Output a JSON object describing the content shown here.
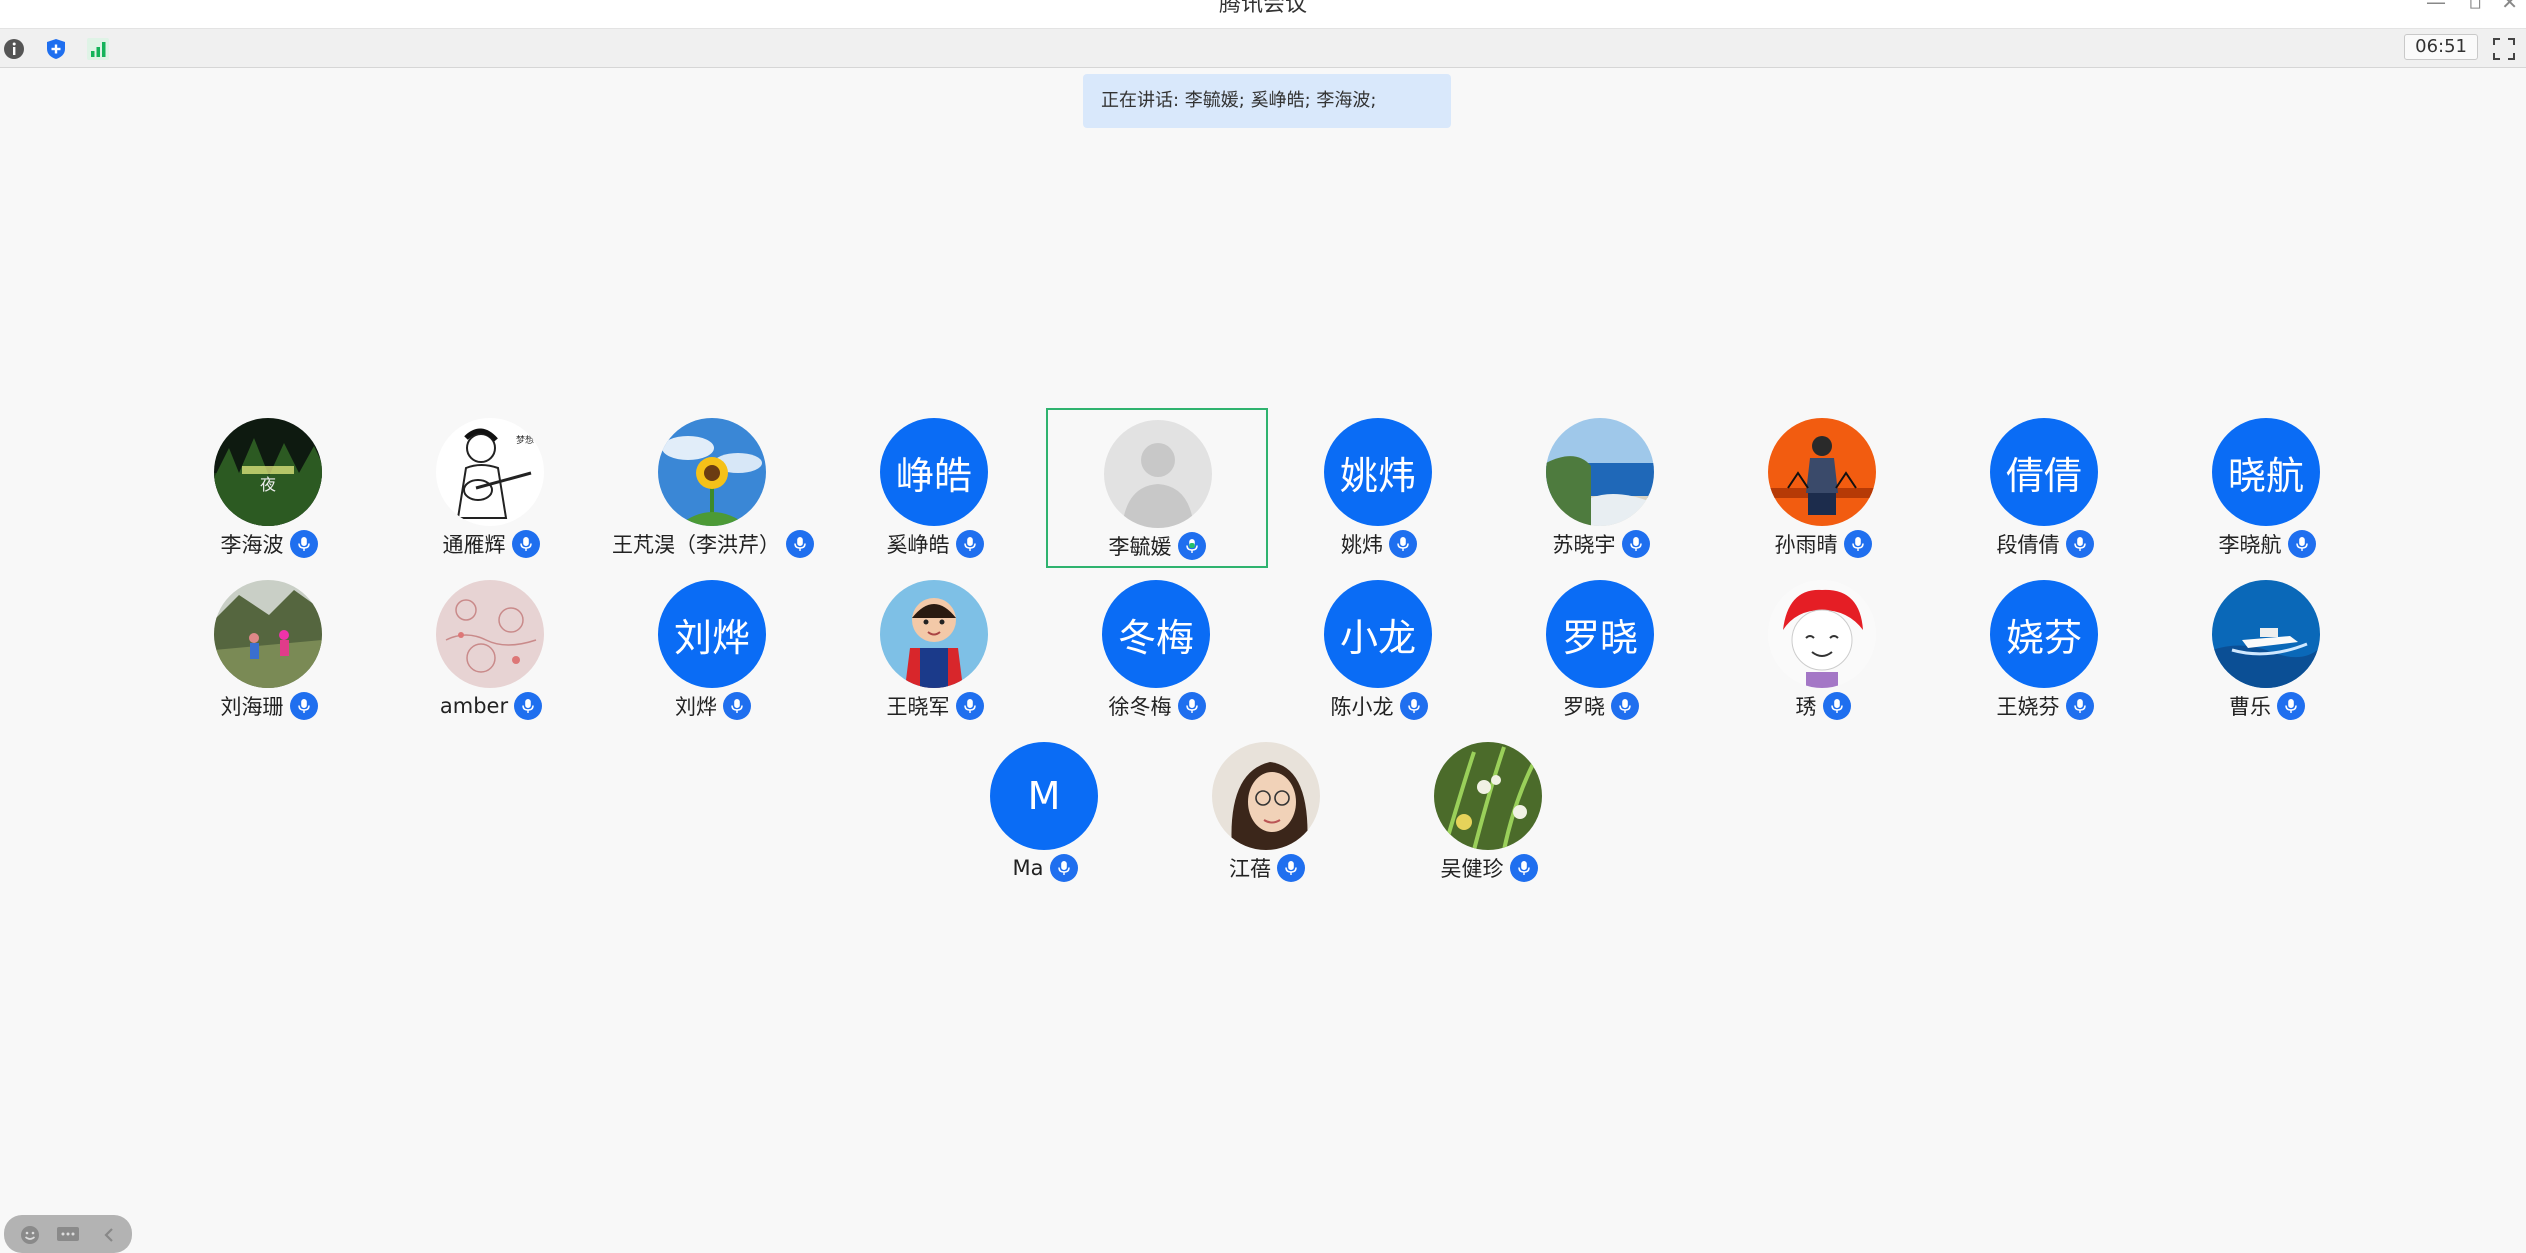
{
  "window": {
    "title": "腾讯会议"
  },
  "toolbar": {
    "timer": "06:51"
  },
  "banner": {
    "speaking_text": "正在讲话: 李毓媛; 奚峥皓; 李海波;"
  },
  "colors": {
    "accent": "#0a6cf5",
    "active_border": "#2fb36f",
    "banner_bg": "#d9e8fb"
  },
  "participants": [
    {
      "name": "李海波",
      "avatar": "photo-night-forest",
      "initials": ""
    },
    {
      "name": "通雁辉",
      "avatar": "photo-sketch-guitar",
      "initials": ""
    },
    {
      "name": "王芃淏（李洪芹）",
      "avatar": "photo-sunflower-sky",
      "initials": ""
    },
    {
      "name": "奚峥皓",
      "avatar": "initials",
      "initials": "峥皓"
    },
    {
      "name": "李毓媛",
      "avatar": "default-user",
      "initials": "",
      "active": true
    },
    {
      "name": "姚炜",
      "avatar": "initials",
      "initials": "姚炜"
    },
    {
      "name": "苏晓宇",
      "avatar": "photo-sea-coast",
      "initials": ""
    },
    {
      "name": "孙雨晴",
      "avatar": "photo-orange-figure",
      "initials": ""
    },
    {
      "name": "段倩倩",
      "avatar": "initials",
      "initials": "倩倩"
    },
    {
      "name": "李晓航",
      "avatar": "initials",
      "initials": "晓航"
    },
    {
      "name": "刘海珊",
      "avatar": "photo-mountain-people",
      "initials": ""
    },
    {
      "name": "amber",
      "avatar": "photo-pink-pattern",
      "initials": ""
    },
    {
      "name": "刘烨",
      "avatar": "initials",
      "initials": "刘烨"
    },
    {
      "name": "王晓军",
      "avatar": "photo-child",
      "initials": ""
    },
    {
      "name": "徐冬梅",
      "avatar": "initials",
      "initials": "冬梅"
    },
    {
      "name": "陈小龙",
      "avatar": "initials",
      "initials": "小龙"
    },
    {
      "name": "罗晓",
      "avatar": "initials",
      "initials": "罗晓"
    },
    {
      "name": "琇",
      "avatar": "photo-cartoon-red-hair",
      "initials": ""
    },
    {
      "name": "王娆芬",
      "avatar": "initials",
      "initials": "娆芬"
    },
    {
      "name": "曹乐",
      "avatar": "photo-boat-sea",
      "initials": ""
    },
    {
      "name": "Ma",
      "avatar": "initials",
      "initials": "M"
    },
    {
      "name": "江蓓",
      "avatar": "photo-woman-glasses",
      "initials": ""
    },
    {
      "name": "吴健珍",
      "avatar": "photo-green-plant",
      "initials": ""
    }
  ]
}
